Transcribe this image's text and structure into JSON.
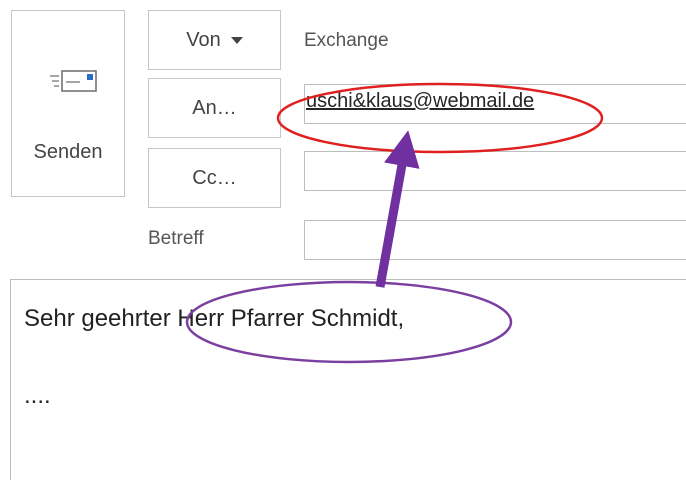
{
  "compose": {
    "send_label": "Senden",
    "from_button_label": "Von",
    "from_account": "Exchange",
    "to_button_label": "An…",
    "to_value": "uschi&klaus@webmail.de",
    "cc_button_label": "Cc…",
    "cc_value": "",
    "subject_label": "Betreff",
    "subject_value": "",
    "body_greeting": "Sehr geehrter Herr Pfarrer Schmidt,",
    "body_continuation": "...."
  },
  "annotations": {
    "recipient_ellipse_color": "#e02020",
    "salutation_ellipse_color": "#7b3fa0",
    "arrow_color": "#7030a0"
  }
}
